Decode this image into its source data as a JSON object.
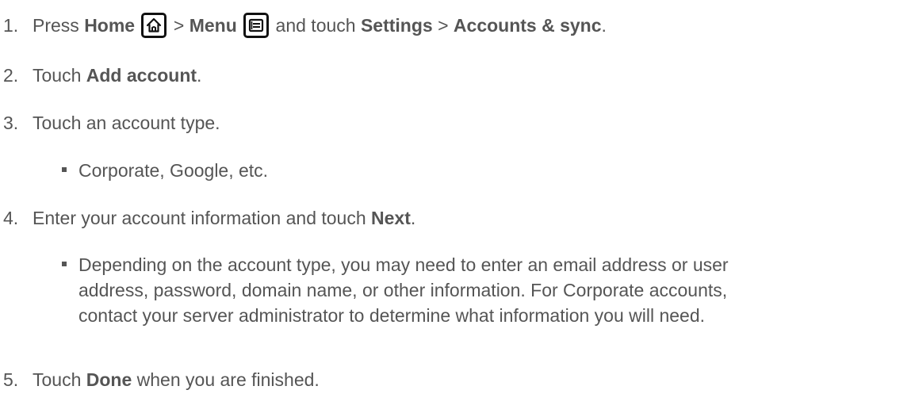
{
  "steps": [
    {
      "number": "1.",
      "parts": {
        "t1": "Press ",
        "home": "Home",
        "sep1": " > ",
        "menu": "Menu",
        "t2": " and touch ",
        "settings": "Settings",
        "sep2": " > ",
        "accounts": "Accounts & sync",
        "end": "."
      },
      "icons": [
        "home-key-icon",
        "menu-key-icon"
      ]
    },
    {
      "number": "2.",
      "parts": {
        "t1": "Touch ",
        "add": "Add account",
        "end": "."
      }
    },
    {
      "number": "3.",
      "text": "Touch an account type.",
      "bullet": "Corporate, Google, etc."
    },
    {
      "number": "4.",
      "parts": {
        "t1": "Enter your account information and touch ",
        "next": "Next",
        "end": "."
      },
      "bullet_lines": [
        "Depending on the account type, you may need to enter an email address or user",
        "address, password, domain name, or other information. For Corporate accounts,",
        "contact your server administrator to determine what information you will need."
      ]
    },
    {
      "number": "5.",
      "parts": {
        "t1": "Touch ",
        "done": "Done",
        "t2": " when you are finished."
      }
    }
  ]
}
